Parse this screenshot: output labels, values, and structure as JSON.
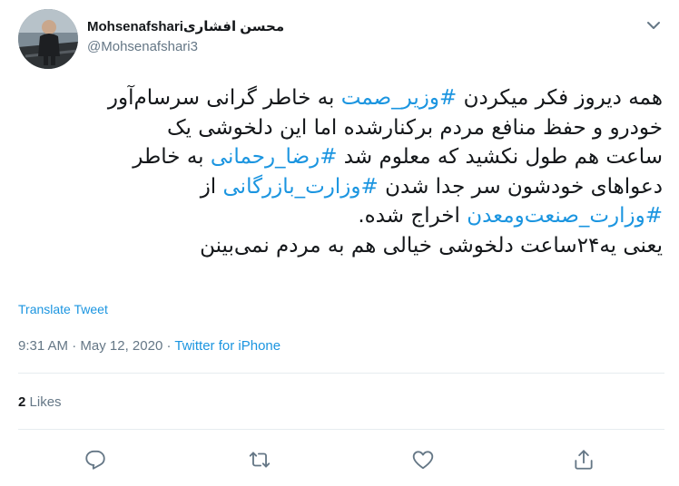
{
  "user": {
    "display_name": "Mohsenafshariمحسن افشاری",
    "handle": "@Mohsenafshari3"
  },
  "tweet": {
    "text_lines": [
      [
        "همه دیروز فکر میکردن ",
        "#وزیر_صمت",
        " به خاطر گرانی سرسام‌آور"
      ],
      [
        "خودرو و حفظ منافع مردم برکنارشده اما این دلخوشی یک"
      ],
      [
        "ساعت هم طول نکشید که معلوم شد ",
        "#رضا_رحمانی",
        " به خاطر"
      ],
      [
        "دعواهای خودشون سر جدا شدن ",
        "#وزارت_بازرگانی",
        " از"
      ],
      [
        "#وزارت_صنعت‌ومعدن",
        " اخراج شده."
      ],
      [
        "یعنی یه۲۴ساعت دلخوشی خیالی هم به مردم نمی‌بینن"
      ]
    ],
    "translate_label": "Translate Tweet",
    "time": "9:31 AM",
    "separator": "·",
    "date": "May 12, 2020",
    "source": "Twitter for iPhone",
    "likes_count": "2",
    "likes_label": "Likes"
  },
  "colors": {
    "link": "#1b95e0",
    "secondary": "#657786",
    "primary": "#14171a",
    "divider": "#e6ecf0"
  },
  "icons": {
    "menu": "chevron-down-icon",
    "reply": "reply-icon",
    "retweet": "retweet-icon",
    "like": "heart-icon",
    "share": "share-icon"
  }
}
